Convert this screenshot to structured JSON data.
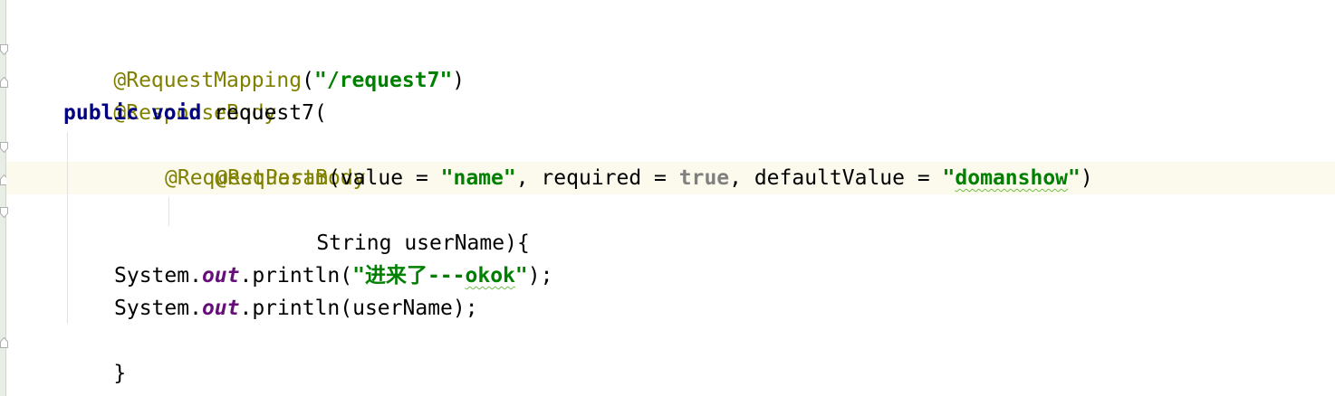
{
  "code": {
    "line1": {
      "annotation": "@RequestMapping",
      "open": "(",
      "path": "\"/request7\"",
      "close": ")"
    },
    "line2": {
      "annotation": "@ResponseBody"
    },
    "line3": {
      "kw_public": "public",
      "kw_void": "void",
      "method": " request7("
    },
    "line4": {
      "annotation": "@RequestBody"
    },
    "line5": {
      "annotation": "@RequestParam",
      "part1": "(value = ",
      "name_str": "\"name\"",
      "part2": ", required = ",
      "true_lit": "true",
      "part3": ", defaultValue = ",
      "default_open_quote": "\"",
      "default_word": "domanshow",
      "default_close_quote": "\"",
      "part4": ")"
    },
    "line6": {
      "text": "String userName){"
    },
    "line8": {
      "system": "System.",
      "out": "out",
      "call": ".println(",
      "str_prefix": "\"进来了---",
      "str_word": "okok",
      "str_suffix": "\"",
      "end": ");"
    },
    "line9": {
      "system": "System.",
      "out": "out",
      "rest": ".println(userName);"
    },
    "line10": {
      "text": "}"
    }
  },
  "colors": {
    "annotation": "#808000",
    "keyword": "#000080",
    "string": "#008000",
    "literal": "#808080",
    "static_field": "#660e7a",
    "current_line_bg": "#fcfaed",
    "gutter_bg": "#e8ede6"
  }
}
